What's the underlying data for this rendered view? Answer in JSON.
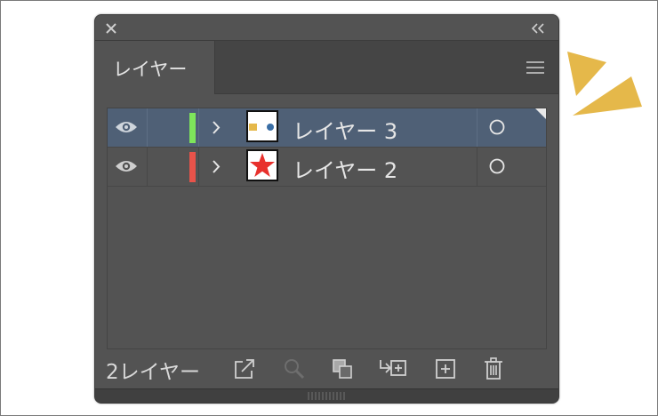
{
  "colors": {
    "panel_bg": "#535353",
    "selected_row": "#4f6076",
    "layer3_color": "#7ee55b",
    "layer2_color": "#e8534a",
    "burst": "#e5b84a"
  },
  "panel": {
    "tab_label": "レイヤー",
    "icons": {
      "close": "close-icon",
      "collapse": "double-chevron-left-icon",
      "menu": "hamburger-menu-icon"
    }
  },
  "layers": [
    {
      "name": "レイヤー 3",
      "selected": true,
      "color": "#7ee55b",
      "thumbnail": "square-dot"
    },
    {
      "name": "レイヤー 2",
      "selected": false,
      "color": "#e8534a",
      "thumbnail": "red-star"
    }
  ],
  "footer": {
    "count_label": "2レイヤー",
    "buttons": [
      "export-icon",
      "locate-object-icon",
      "clipping-mask-icon",
      "new-sublayer-icon",
      "new-layer-icon",
      "trash-icon"
    ]
  }
}
